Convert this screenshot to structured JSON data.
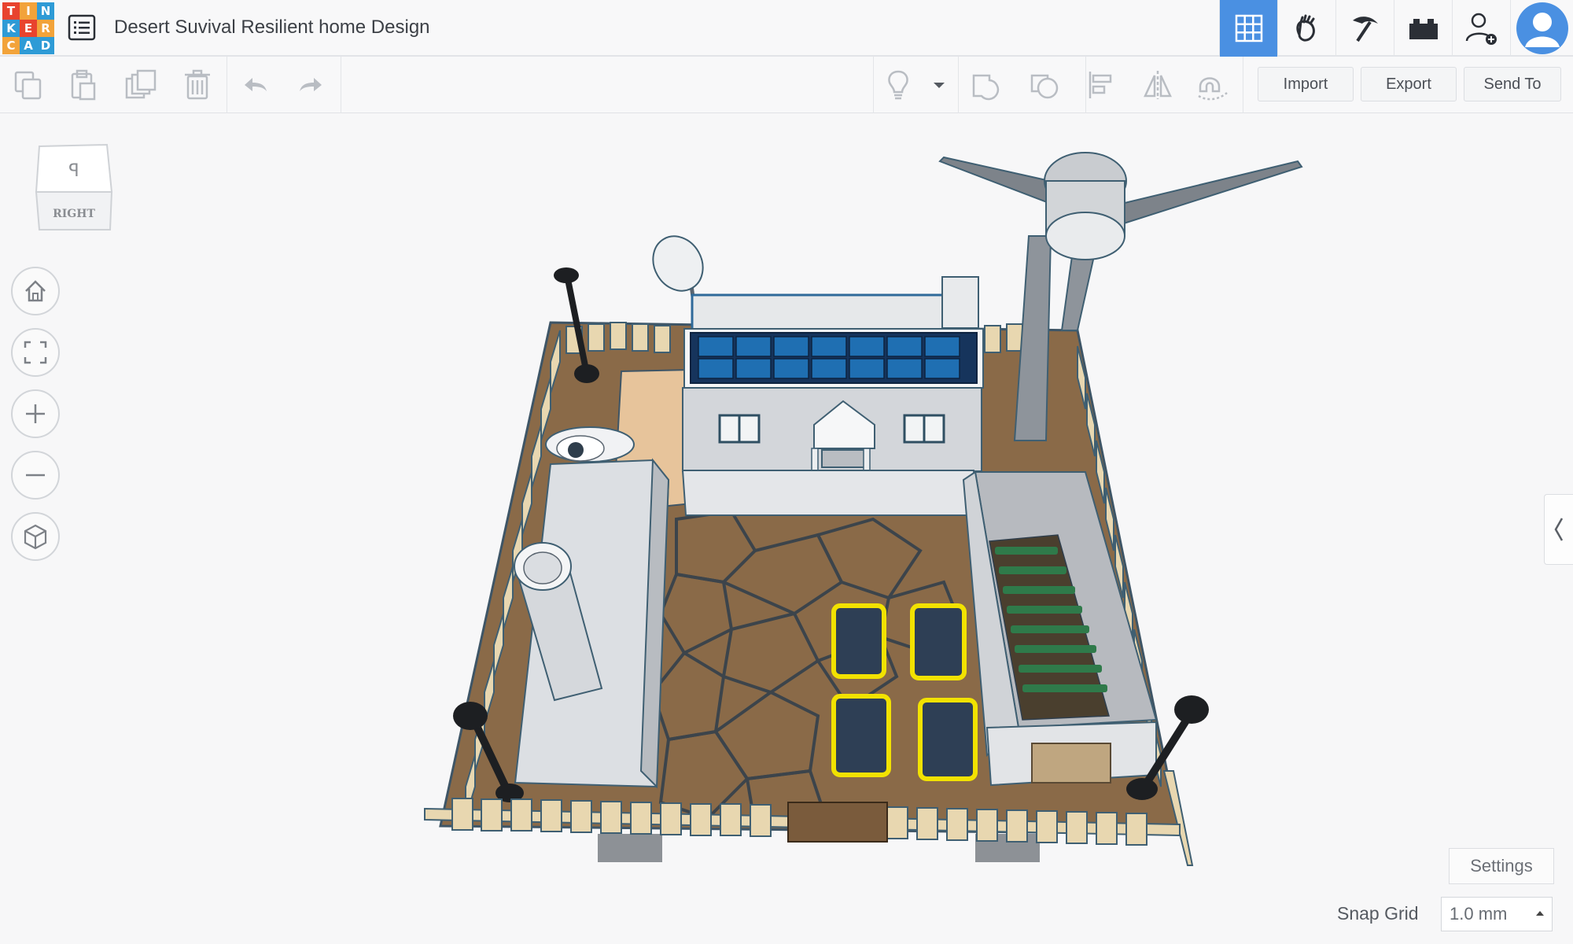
{
  "app": {
    "logo_letters": [
      "T",
      "I",
      "N",
      "K",
      "E",
      "R",
      "C",
      "A",
      "D"
    ],
    "logo_colors": [
      "#e8432e",
      "#f2a33a",
      "#2e9bd6",
      "#2e9bd6",
      "#e8432e",
      "#f2a33a",
      "#f2a33a",
      "#2e9bd6",
      "#2e9bd6"
    ],
    "title": "Desert Suvival Resilient home Design"
  },
  "top_icons": [
    {
      "name": "3d-design-icon",
      "active": true
    },
    {
      "name": "codeblocks-icon",
      "active": false
    },
    {
      "name": "minecraft-pickaxe-icon",
      "active": false
    },
    {
      "name": "lego-brick-icon",
      "active": false
    },
    {
      "name": "add-user-icon",
      "active": false
    },
    {
      "name": "user-avatar",
      "active": false
    }
  ],
  "toolbar": {
    "left_tools": [
      "copy-icon",
      "paste-icon",
      "duplicate-icon",
      "delete-icon",
      "undo-icon",
      "redo-icon"
    ],
    "right_tools": [
      "light-bulb-icon",
      "dropdown-arrow-icon",
      "group-icon",
      "ungroup-icon",
      "align-icon",
      "mirror-icon",
      "cruise-magnet-icon"
    ],
    "import_label": "Import",
    "export_label": "Export",
    "send_to_label": "Send To"
  },
  "viewcube": {
    "face_label": "RIGHT",
    "top_glyph": "ꟼ"
  },
  "nav_buttons": [
    "home-view-icon",
    "fit-view-icon",
    "zoom-in-icon",
    "zoom-out-icon",
    "ortho-perspective-icon"
  ],
  "bottom": {
    "settings_label": "Settings",
    "snap_grid_label": "Snap Grid",
    "snap_grid_value": "1.0 mm"
  },
  "colors": {
    "accent": "#4a90e2",
    "ground": "#8a6a48",
    "fence": "#e8d7b0",
    "solar_blue": "#1f6fb2",
    "highlight_yellow": "#f2e200"
  }
}
